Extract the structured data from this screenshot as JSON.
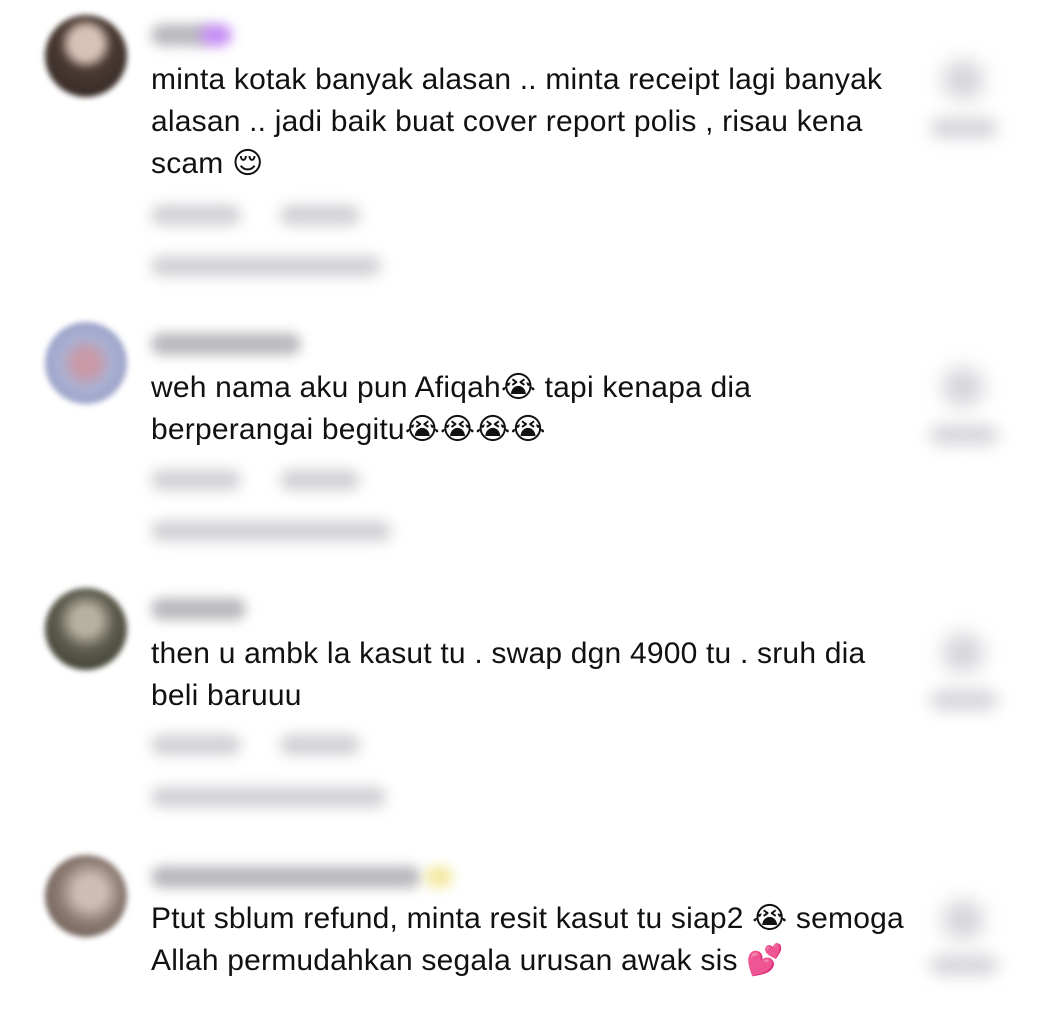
{
  "comments": [
    {
      "username": "",
      "text": "minta kotak banyak alasan .. minta receipt lagi banyak alasan .. jadi baik buat cover report polis , risau kena scam 😌",
      "avatar_color": "#3a2d28",
      "username_color": "#b9b9bd",
      "username_badge_color": "#c58cf4"
    },
    {
      "username": "",
      "text": "weh nama aku pun Afiqah😭 tapi kenapa dia berperangai begitu😭😭😭😭",
      "avatar_color": "#9aa2c4",
      "username_color": "#b9b9bd"
    },
    {
      "username": "",
      "text": "then u ambk la kasut tu . swap dgn 4900 tu . sruh dia beli baruuu",
      "avatar_color": "#5b5a4b",
      "username_color": "#b9b9bd"
    },
    {
      "username": "",
      "text": "Ptut sblum refund, minta resit kasut tu siap2 😭 semoga Allah permudahkan segala urusan awak sis 💕",
      "avatar_color": "#8e7d74",
      "username_color": "#b9b9bd",
      "username_badge_color": "#f3e9a2"
    }
  ]
}
